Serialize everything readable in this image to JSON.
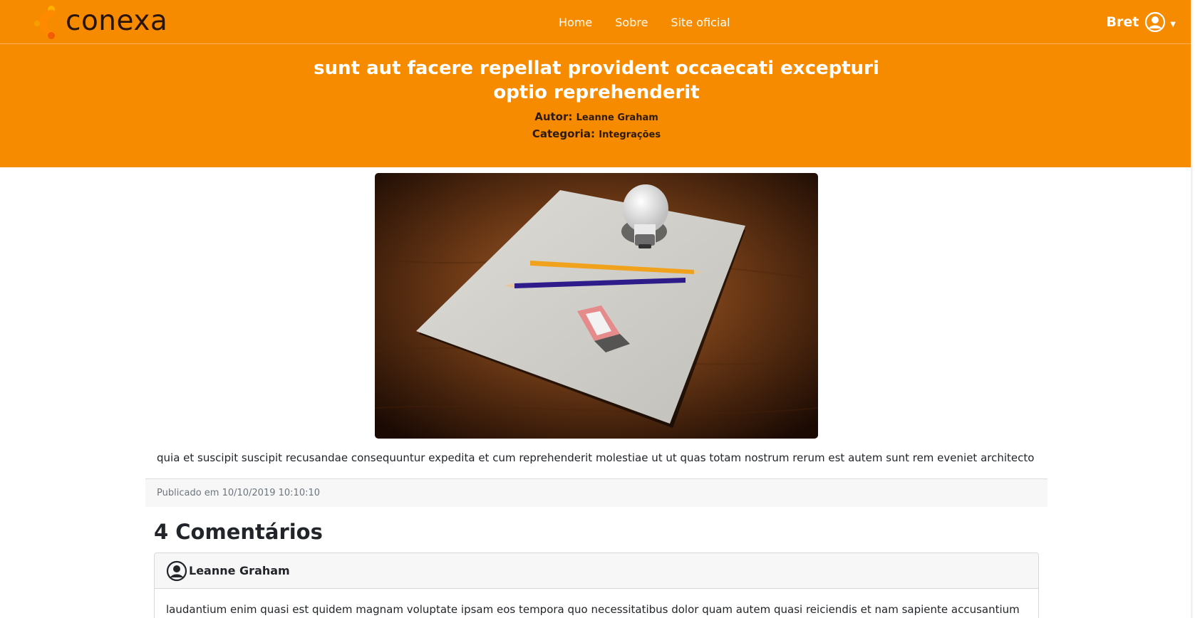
{
  "brand": {
    "name": "conexa",
    "icon": "conexa-logo-icon"
  },
  "nav": {
    "links": [
      "Home",
      "Sobre",
      "Site oficial"
    ]
  },
  "user": {
    "name": "Bret",
    "icon": "user-circle-icon",
    "caret_icon": "chevron-down-icon"
  },
  "post": {
    "title": "sunt aut facere repellat provident occaecati excepturi optio reprehenderit",
    "author_label": "Autor:",
    "author": "Leanne Graham",
    "category_label": "Categoria:",
    "category": "Integrações",
    "body": "quia et suscipit suscipit recusandae consequuntur expedita et cum reprehenderit molestiae ut ut quas totam nostrum rerum est autem sunt rem eveniet architecto",
    "published": "Publicado em 10/10/2019 10:10:10"
  },
  "comments": {
    "heading": "4 Comentários",
    "items": [
      {
        "author": "Leanne Graham",
        "icon": "user-circle-icon",
        "body": "laudantium enim quasi est quidem magnam voluptate ipsam eos tempora quo necessitatibus dolor quam autem quasi reiciendis et nam sapiente accusantium"
      }
    ]
  },
  "colors": {
    "brand_orange": "#f68b00",
    "brand_dark": "#2a1505"
  }
}
